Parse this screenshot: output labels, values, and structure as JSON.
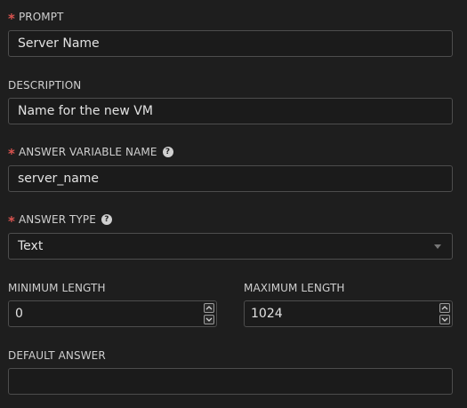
{
  "form": {
    "prompt": {
      "label": "PROMPT",
      "required": true,
      "value": "Server Name"
    },
    "description": {
      "label": "DESCRIPTION",
      "required": false,
      "value": "Name for the new VM"
    },
    "answer_variable_name": {
      "label": "ANSWER VARIABLE NAME",
      "required": true,
      "help_icon": "question-circle-icon",
      "value": "server_name"
    },
    "answer_type": {
      "label": "ANSWER TYPE",
      "required": true,
      "help_icon": "question-circle-icon",
      "value": "Text"
    },
    "minimum_length": {
      "label": "MINIMUM LENGTH",
      "value": "0"
    },
    "maximum_length": {
      "label": "MAXIMUM LENGTH",
      "value": "1024"
    },
    "default_answer": {
      "label": "DEFAULT ANSWER",
      "value": ""
    }
  },
  "colors": {
    "background": "#1e1e1e",
    "required_marker": "#d9534f",
    "input_border": "#4d4d4d"
  }
}
